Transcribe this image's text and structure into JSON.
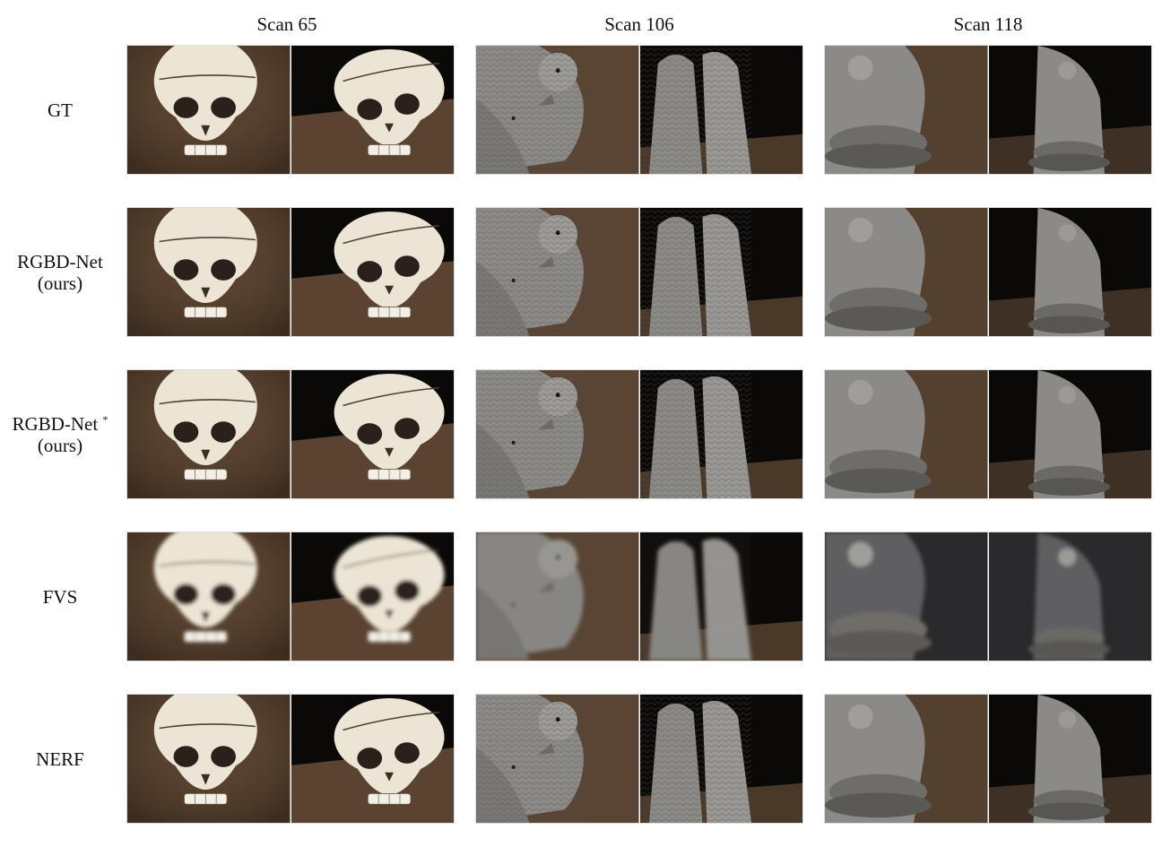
{
  "columns": [
    {
      "id": "scan65",
      "label": "Scan 65",
      "object": "skull"
    },
    {
      "id": "scan106",
      "label": "Scan 106",
      "object": "birds"
    },
    {
      "id": "scan118",
      "label": "Scan 118",
      "object": "angel"
    }
  ],
  "rows": [
    {
      "id": "gt",
      "line1": "GT",
      "line2": "",
      "star": "",
      "quality": "sharp"
    },
    {
      "id": "rgbd",
      "line1": "RGBD-Net",
      "line2": "(ours)",
      "star": "",
      "quality": "sharp"
    },
    {
      "id": "rgbdstar",
      "line1": "RGBD-Net",
      "line2": "(ours)",
      "star": "*",
      "quality": "sharp"
    },
    {
      "id": "fvs",
      "line1": "FVS",
      "line2": "",
      "star": "",
      "quality": "blurry"
    },
    {
      "id": "nerf",
      "line1": "NERF",
      "line2": "",
      "star": "",
      "quality": "sharp"
    }
  ],
  "colors": {
    "background": "#ffffff",
    "text": "#111111",
    "table_brown": "#5a4330",
    "backdrop_dark": "#0b0908",
    "bone": "#ece4d4",
    "stone": "#8c8a86",
    "fvs_tint": "#2a2a2c"
  }
}
